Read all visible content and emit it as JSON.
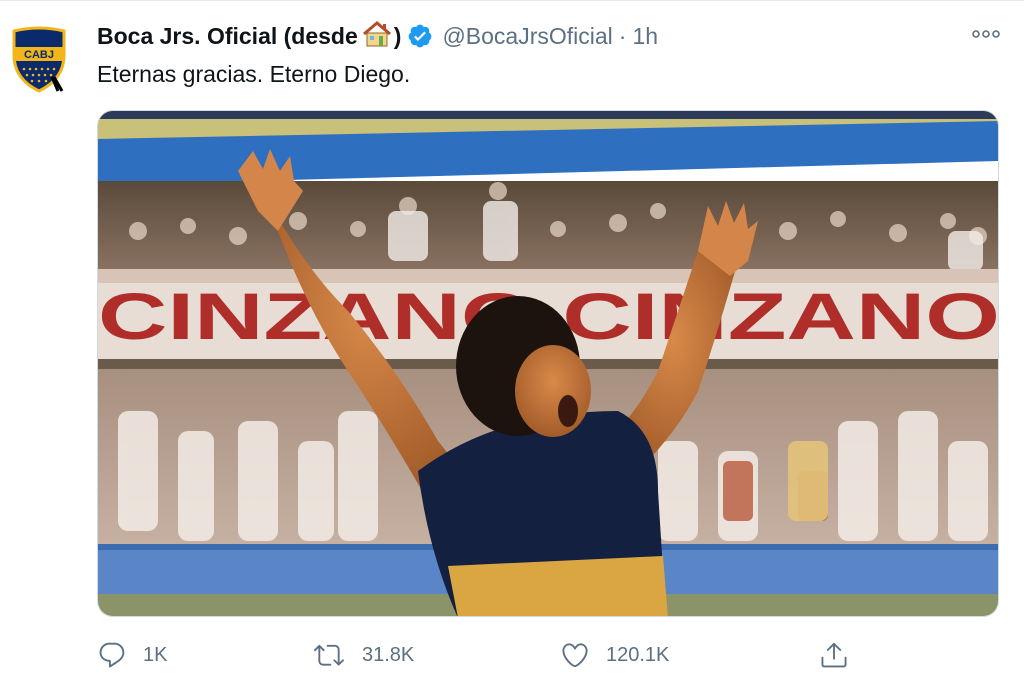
{
  "tweet": {
    "author": {
      "display_name": "Boca Jrs. Oficial (desde",
      "display_name_suffix": ")",
      "emoji": "house-emoji",
      "verified": true,
      "handle": "@BocaJrsOficial",
      "time": "1h",
      "avatar_text": "CABJ"
    },
    "text": "Eternas gracias. Eterno Diego.",
    "media": {
      "stadium_banner_text": "CINZANO  CINZANO"
    },
    "actions": {
      "reply_count": "1K",
      "retweet_count": "31.8K",
      "like_count": "120.1K"
    }
  },
  "colors": {
    "text_primary": "#0f1419",
    "text_secondary": "#5b7083",
    "verified_blue": "#1d9bf0",
    "boca_blue": "#0a2a6b",
    "boca_gold": "#f2b61b"
  }
}
